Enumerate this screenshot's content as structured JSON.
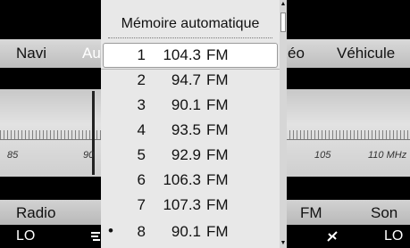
{
  "top_menu": {
    "left_item": "Navi",
    "partial_left_item": "Au",
    "partial_right_item": "éo",
    "right_item": "Véhicule"
  },
  "frequency_scale": {
    "labels": [
      "85",
      "90",
      "105",
      "110 MHz"
    ]
  },
  "function_bar": {
    "left_item": "Radio",
    "right_partial_item": "FM",
    "right_item": "Son"
  },
  "status_bar": {
    "left_item": "LO",
    "right_item": "LO",
    "left_icon": "fan-icon",
    "right_icon": "fan-icon"
  },
  "popup": {
    "title": "Mémoire automatique",
    "stations": [
      {
        "number": "1",
        "frequency": "104.3",
        "band": "FM",
        "selected": true,
        "active": false
      },
      {
        "number": "2",
        "frequency": "94.7",
        "band": "FM",
        "selected": false,
        "active": false
      },
      {
        "number": "3",
        "frequency": "90.1",
        "band": "FM",
        "selected": false,
        "active": false
      },
      {
        "number": "4",
        "frequency": "93.5",
        "band": "FM",
        "selected": false,
        "active": false
      },
      {
        "number": "5",
        "frequency": "92.9",
        "band": "FM",
        "selected": false,
        "active": false
      },
      {
        "number": "6",
        "frequency": "106.3",
        "band": "FM",
        "selected": false,
        "active": false
      },
      {
        "number": "7",
        "frequency": "107.3",
        "band": "FM",
        "selected": false,
        "active": false
      },
      {
        "number": "8",
        "frequency": "90.1",
        "band": "FM",
        "selected": false,
        "active": true
      }
    ],
    "active_marker": "•"
  },
  "scrollbar": {
    "up_arrow": "▲",
    "down_arrow": "▼"
  }
}
